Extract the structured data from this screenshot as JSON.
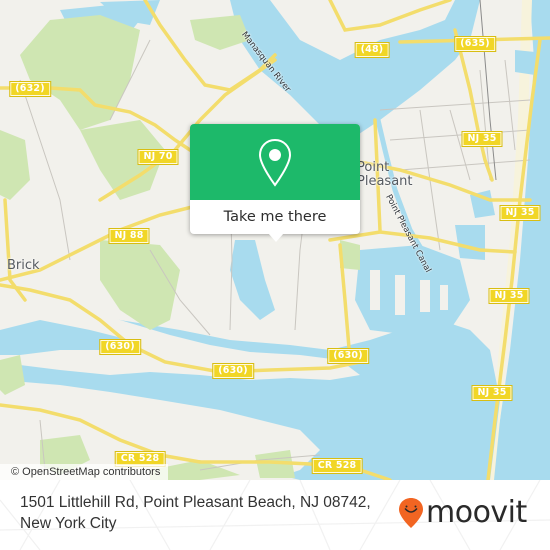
{
  "map": {
    "colors": {
      "land": "#f2f1ec",
      "water": "#a8dbee",
      "park": "#cfe6b2",
      "road_major": "#f3dd6c",
      "road_minor": "#c9c6c0",
      "shield_fill": "#f1d626"
    },
    "places": [
      {
        "name": "Brick"
      },
      {
        "name": "Point Pleasant"
      }
    ],
    "water_labels": [
      {
        "name": "Manasquan River"
      },
      {
        "name": "Point Pleasant Canal"
      }
    ],
    "road_shields": [
      {
        "label": "(632)"
      },
      {
        "label": "NJ 70"
      },
      {
        "label": "(48)"
      },
      {
        "label": "(635)"
      },
      {
        "label": "NJ 35"
      },
      {
        "label": "NJ 88"
      },
      {
        "label": "NJ 35"
      },
      {
        "label": "NJ 35"
      },
      {
        "label": "(630)"
      },
      {
        "label": "(630)"
      },
      {
        "label": "(630)"
      },
      {
        "label": "NJ 35"
      },
      {
        "label": "CR 528"
      },
      {
        "label": "CR 528"
      }
    ],
    "attribution": "© OpenStreetMap contributors"
  },
  "popup": {
    "icon": "location-pin-icon",
    "button_label": "Take me there",
    "accent_color": "#1db96a"
  },
  "footer": {
    "address": "1501 Littlehill Rd, Point Pleasant Beach, NJ 08742, New York City",
    "logo_text": "moovit",
    "logo_icon": "moovit-pin-icon",
    "logo_color": "#f26522"
  }
}
